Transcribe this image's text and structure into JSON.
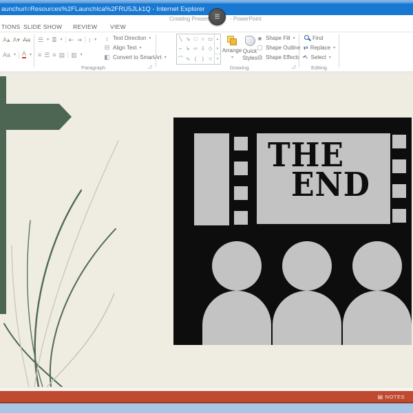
{
  "browser": {
    "title": "aunchurl=Resources%2FLaunchIca%2FRU5JLk1Q - Internet Explorer"
  },
  "app_titlebar": {
    "title_fragment_left": "Creating Presen",
    "title_fragment_right": "- PowerPoint"
  },
  "ribbon": {
    "tabs": [
      {
        "label": "TIONS"
      },
      {
        "label": "SLIDE SHOW"
      },
      {
        "label": "REVIEW"
      },
      {
        "label": "VIEW"
      }
    ],
    "font_group": {
      "grow_font": "A▴",
      "shrink_font": "A▾",
      "clear_formatting": "Aa",
      "change_case": "Aa",
      "font_color": "A"
    },
    "paragraph_group": {
      "label": "Paragraph",
      "text_direction": "Text Direction",
      "align_text": "Align Text",
      "convert_smartart": "Convert to SmartArt"
    },
    "drawing_group": {
      "label": "Drawing",
      "arrange": "Arrange",
      "quick_styles_line1": "Quick",
      "quick_styles_line2": "Styles",
      "shape_fill": "Shape Fill",
      "shape_outline": "Shape Outline",
      "shape_effects": "Shape Effects",
      "shapes": [
        "╲",
        "⇘",
        "□",
        "○",
        "▭",
        "⌐",
        "↳",
        "⇨",
        "⇩",
        "◇",
        "⌒",
        "∿",
        "(",
        ")",
        "☆"
      ]
    },
    "editing_group": {
      "label": "Editing",
      "find": "Find",
      "replace": "Replace",
      "select": "Select"
    }
  },
  "icons": {
    "caret": "▾",
    "bullets": "☰",
    "numbering": "≣",
    "outdent": "⇤",
    "indent": "⇥",
    "line_spacing": "↕",
    "align_left": "≡",
    "align_center": "☰",
    "align_right": "≡",
    "justify": "▤",
    "columns": "▥",
    "text_direction": "↕",
    "align_text": "⊟",
    "smartart": "◧",
    "shape_fill": "■",
    "shape_outline": "▢",
    "shape_effects": "◍",
    "select": "↖",
    "replace": "⇄",
    "scroll_up": "▴",
    "scroll_down": "▾",
    "scroll_more": "▾",
    "launcher": "◿",
    "badge_menu": "☰",
    "notes": "▤"
  },
  "slide": {
    "clipart_text_line1": "THE",
    "clipart_text_line2": "END"
  },
  "status_bar": {
    "notes_label": "NOTES"
  },
  "colors": {
    "ie_titlebar_blue": "#1878D2",
    "status_bar_red": "#C04A31",
    "slide_background": "#EFECE2",
    "slide_accent_green": "#4D6553",
    "clipart_black": "#0D0D0D",
    "clipart_gray": "#C3C3C3",
    "bottom_strip_blue": "#A9C6E6"
  }
}
